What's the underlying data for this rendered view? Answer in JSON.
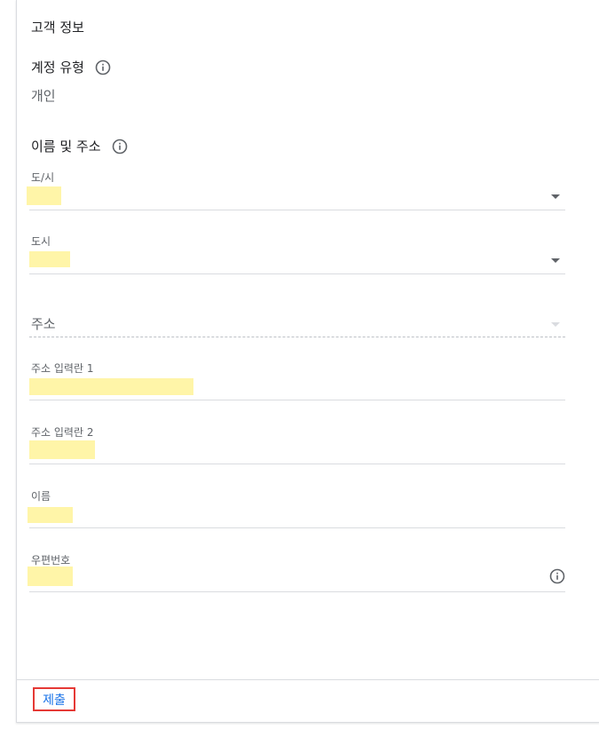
{
  "section": {
    "title": "고객 정보"
  },
  "account_type": {
    "label": "계정 유형",
    "value": "개인"
  },
  "name_address": {
    "label": "이름 및 주소"
  },
  "fields": {
    "province": {
      "label": "도/시"
    },
    "city": {
      "label": "도시"
    },
    "address": {
      "placeholder": "주소"
    },
    "address_line1": {
      "label": "주소 입력란 1"
    },
    "address_line2": {
      "label": "주소 입력란 2"
    },
    "name": {
      "label": "이름"
    },
    "postal_code": {
      "label": "우편번호"
    }
  },
  "footer": {
    "submit_label": "제출"
  },
  "colors": {
    "highlight": "#fff5a8",
    "accent": "#1a73e8",
    "submit_outline": "#e53935"
  },
  "icons": {
    "info": "info-circle-icon",
    "dropdown": "caret-down-icon"
  }
}
